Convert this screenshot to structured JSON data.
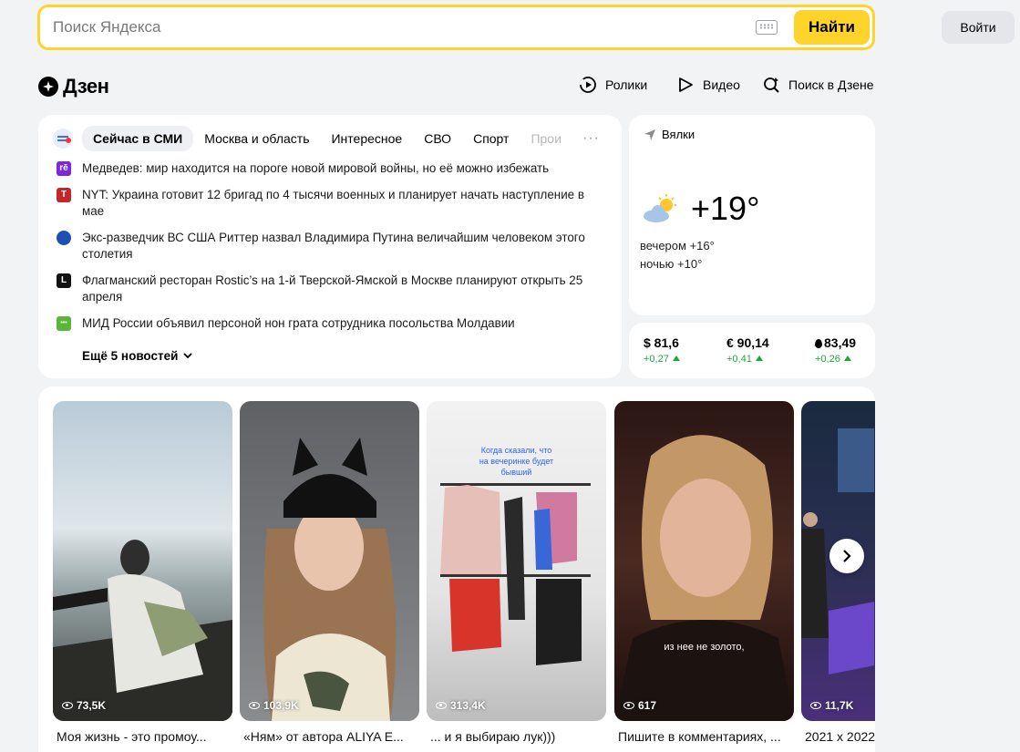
{
  "search": {
    "placeholder": "Поиск Яндекса",
    "button": "Найти"
  },
  "login": "Войти",
  "zen": {
    "logo": "Дзен",
    "nav": [
      {
        "label": "Ролики",
        "icon": "clips-icon"
      },
      {
        "label": "Видео",
        "icon": "play-icon"
      },
      {
        "label": "Поиск в Дзене",
        "icon": "zen-search-icon"
      }
    ]
  },
  "news": {
    "tabs": [
      "Сейчас в СМИ",
      "Москва и область",
      "Интересное",
      "СВО",
      "Спорт",
      "Происшествия"
    ],
    "items": [
      {
        "source_mark": "rē",
        "color": "#7a2ad8",
        "text": "Медведев: мир находится на пороге новой мировой войны, но её можно избежать"
      },
      {
        "source_mark": "Т",
        "color": "#c4262e",
        "text": "NYT: Украина готовит 12 бригад по 4 тысячи военных и планирует начать наступление в мае"
      },
      {
        "source_mark": "",
        "color": "#1f4fb5",
        "text": "Экс-разведчик ВС США Риттер назвал Владимира Путина величайшим человеком этого столетия"
      },
      {
        "source_mark": "L",
        "color": "#111111",
        "text": "Флагманский ресторан Rostic’s на 1-й Тверской-Ямской в Москве планируют открыть 25 апреля"
      },
      {
        "source_mark": "•••",
        "color": "#5bb53a",
        "text": "МИД России объявил персоной нон грата сотрудника посольства Молдавии"
      }
    ],
    "more": "Ещё 5 новостей"
  },
  "weather": {
    "location": "Вялки",
    "temp": "+19°",
    "evening": "вечером +16°",
    "night": "ночью +10°"
  },
  "rates": [
    {
      "label": "$ 81,6",
      "change": "+0,27"
    },
    {
      "label": "€ 90,14",
      "change": "+0,41"
    },
    {
      "label": "83,49",
      "change": "+0,26"
    }
  ],
  "clips": [
    {
      "views": "73,5K",
      "title": "Моя жизнь - это промоу..."
    },
    {
      "views": "103,9K",
      "title": "«Ням» от автора ALIYA E..."
    },
    {
      "views": "313,4K",
      "title": "... и я выбираю лук)))",
      "caption": "Когда сказали, что на вечеринке будет бывший"
    },
    {
      "views": "617",
      "title": "Пишите в комментариях, ...",
      "caption": "из нее не золото,"
    },
    {
      "views": "11,7K",
      "title": "2021 x 2022"
    }
  ]
}
